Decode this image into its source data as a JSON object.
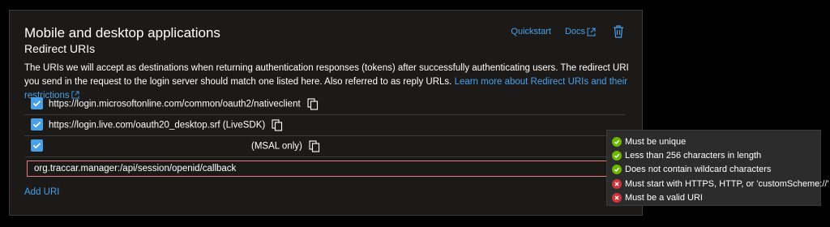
{
  "section": {
    "title": "Mobile and desktop applications",
    "subtitle": "Redirect URIs",
    "description": "The URIs we will accept as destinations when returning authentication responses (tokens) after successfully authenticating users. The redirect URI you send in the request to the login server should match one listed here. Also referred to as reply URLs.",
    "learn_more": "Learn more about Redirect URIs and their restrictions"
  },
  "actions": {
    "quickstart": "Quickstart",
    "docs": "Docs"
  },
  "uris": [
    {
      "checked": true,
      "text": "https://login.microsoftonline.com/common/oauth2/nativeclient"
    },
    {
      "checked": true,
      "text": "https://login.live.com/oauth20_desktop.srf (LiveSDK)"
    },
    {
      "checked": true,
      "text": "(MSAL only)"
    }
  ],
  "custom_uri": {
    "value": "org.traccar.manager:/api/session/openid/callback"
  },
  "add_uri": "Add URI",
  "validation": [
    {
      "status": "pass",
      "text": "Must be unique"
    },
    {
      "status": "pass",
      "text": "Less than 256 characters in length"
    },
    {
      "status": "pass",
      "text": "Does not contain wildcard characters"
    },
    {
      "status": "fail",
      "text": "Must start with HTTPS, HTTP, or 'customScheme://'"
    },
    {
      "status": "fail",
      "text": "Must be a valid URI"
    }
  ],
  "colors": {
    "accent": "#4aa0e6",
    "error_border": "#e37d80",
    "pass": "#6bb700",
    "fail": "#d13438"
  }
}
